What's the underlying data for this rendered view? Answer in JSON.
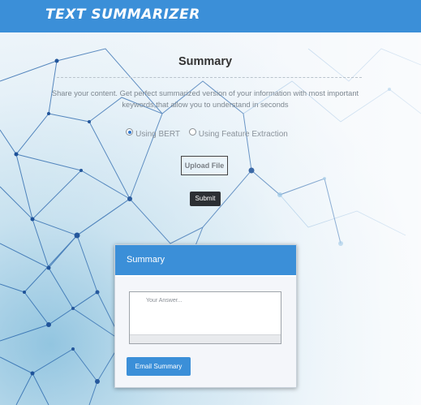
{
  "header": {
    "logo_text": "TEXT SUMMARIZER",
    "bar_color": "#3b8fd8"
  },
  "main": {
    "title": "Summary",
    "description": "Share your content. Get perfect summarized version of your information with most important keywords,that allow you to understand in seconds",
    "options": [
      {
        "label": "Using BERT",
        "selected": true
      },
      {
        "label": "Using Feature Extraction",
        "selected": false
      }
    ],
    "upload_label": "Upload File",
    "submit_label": "Submit"
  },
  "summary_card": {
    "title": "Summary",
    "answer_placeholder": "Your Answer...",
    "answer_value": "",
    "email_button_label": "Email Summary"
  }
}
